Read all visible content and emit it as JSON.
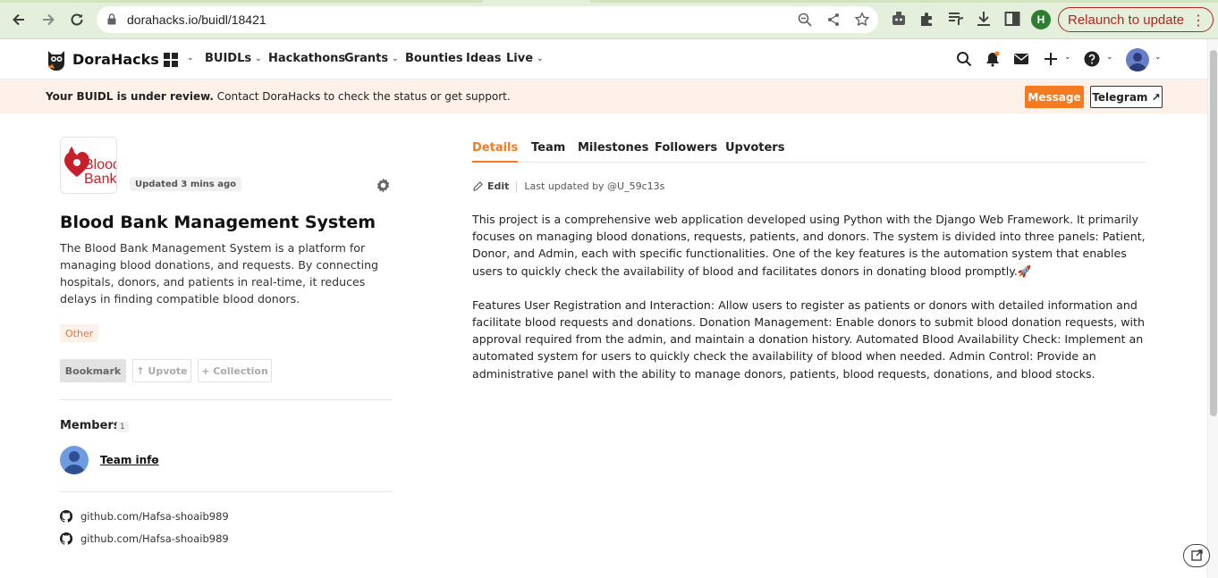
{
  "browser": {
    "url": "dorahacks.io/buidl/18421",
    "profile_initial": "H",
    "relaunch_label": "Relaunch to update"
  },
  "header": {
    "brand": "DoraHacks",
    "nav": [
      {
        "label": "BUIDLs",
        "has_dropdown": true
      },
      {
        "label": "Hackathons",
        "has_dropdown": false
      },
      {
        "label": "Grants",
        "has_dropdown": true
      },
      {
        "label": "Bounties",
        "has_dropdown": false
      },
      {
        "label": "Ideas",
        "has_dropdown": false
      },
      {
        "label": "Live",
        "has_dropdown": true
      }
    ]
  },
  "banner": {
    "bold": "Your BUIDL is under review.",
    "text": " Contact DoraHacks to check the status or get support.",
    "message_button": "Message",
    "telegram_button": "Telegram ↗"
  },
  "project": {
    "logo_text": "Blood Bank",
    "updated": "Updated 3 mins ago",
    "title": "Blood Bank Management System",
    "description": "The Blood Bank Management System is a platform for managing blood donations, and requests. By connecting hospitals, donors, and patients in real-time, it reduces delays in finding compatible blood donors.",
    "tag": "Other",
    "actions": {
      "bookmark": "Bookmark",
      "upvote": "↑ Upvote",
      "collection": "+ Collection"
    }
  },
  "members": {
    "title": "Members",
    "count": "1",
    "team_info": "Team info",
    "arrow": "→"
  },
  "links": [
    {
      "label": "github.com/Hafsa-shoaib989"
    },
    {
      "label": "github.com/Hafsa-shoaib989"
    }
  ],
  "tabs": [
    "Details",
    "Team",
    "Milestones",
    "Followers",
    "Upvoters"
  ],
  "active_tab": "Details",
  "edit": {
    "label": "Edit",
    "last_updated": "Last updated by @U_59c13s"
  },
  "details": {
    "paragraph1": "This project is a comprehensive web application developed using Python with the Django Web Framework. It primarily focuses on managing blood donations, requests, patients, and donors. The system is divided into three panels: Patient, Donor, and Admin, each with specific functionalities. One of the key features is the automation system that enables users to quickly check the availability of blood and facilitates donors in donating blood promptly.🚀",
    "paragraph2": "Features User Registration and Interaction: Allow users to register as patients or donors with detailed information and facilitate blood requests and donations. Donation Management: Enable donors to submit blood donation requests, with approval required from the admin, and maintain a donation history. Automated Blood Availability Check: Implement an automated system for users to quickly check the availability of blood when needed. Admin Control: Provide an administrative panel with the ability to manage donors, patients, blood requests, donations, and blood stocks."
  },
  "colors": {
    "accent": "#f47b20",
    "banner_bg": "#fdf1ea",
    "chrome_bg": "#e4f0dc",
    "relaunch": "#b3261e"
  }
}
